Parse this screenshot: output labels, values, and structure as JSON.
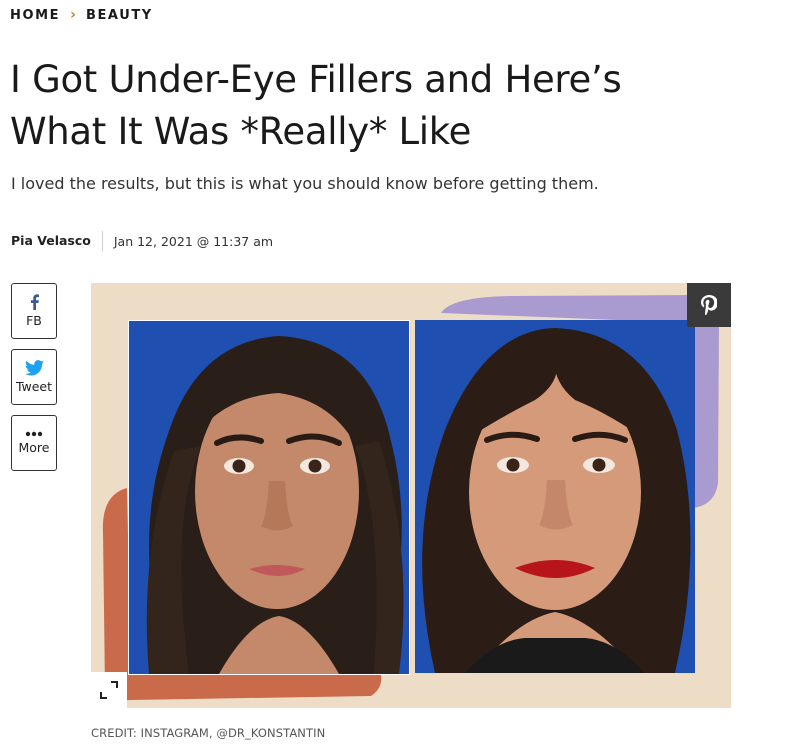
{
  "breadcrumb": {
    "home": "HOME",
    "separator": "›",
    "section": "BEAUTY"
  },
  "article": {
    "title_line1": "I Got Under-Eye Fillers and Here’s",
    "title_line2": "What It Was *Really* Like",
    "dek": "I loved the results, but this is what you should know before getting them.",
    "author": "Pia Velasco",
    "date": "Jan 12, 2021 @ 11:37 am"
  },
  "share": {
    "facebook_label": "FB",
    "twitter_label": "Tweet",
    "more_label": "More",
    "facebook_icon": "facebook-icon",
    "twitter_icon": "twitter-bird-icon",
    "more_icon": "ellipsis-icon"
  },
  "figure": {
    "pinterest_icon": "pinterest-icon",
    "expand_icon": "expand-icon",
    "credit": "CREDIT: INSTAGRAM, @DR_KONSTANTIN",
    "colors": {
      "background": "#eddcc6",
      "accent_orange": "#c96a4a",
      "accent_lavender": "#a99ad0",
      "photo_backdrop": "#1f4fb0"
    }
  },
  "colors": {
    "breadcrumb_separator": "#b8862f",
    "facebook_blue": "#3b5998",
    "twitter_blue": "#1da1f2"
  }
}
